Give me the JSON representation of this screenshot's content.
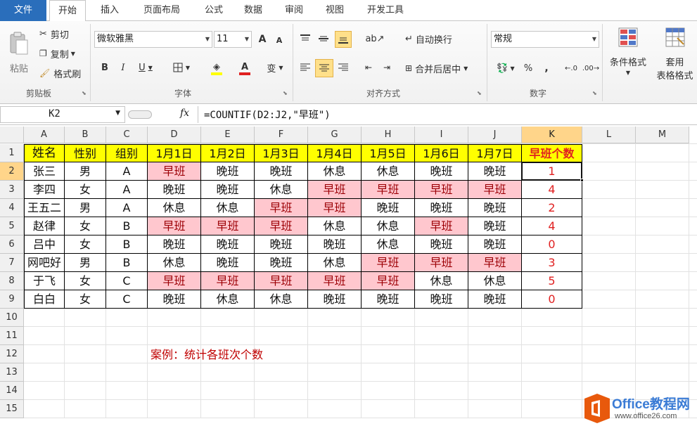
{
  "tabs": {
    "file": "文件",
    "items": [
      "开始",
      "插入",
      "页面布局",
      "公式",
      "数据",
      "审阅",
      "视图",
      "开发工具"
    ],
    "active_index": 0
  },
  "ribbon": {
    "clipboard": {
      "paste": "粘贴",
      "cut": "剪切",
      "copy": "复制",
      "format_painter": "格式刷",
      "group": "剪贴板"
    },
    "font": {
      "name": "微软雅黑",
      "size": "11",
      "group": "字体",
      "bold": "B",
      "italic": "I",
      "underline": "U",
      "grow": "A",
      "shrink": "A",
      "wen": "变"
    },
    "alignment": {
      "wrap": "自动换行",
      "merge": "合并后居中",
      "group": "对齐方式"
    },
    "number": {
      "format": "常规",
      "percent": "%",
      "comma": ",",
      "group": "数字"
    },
    "styles": {
      "conditional": "条件格式",
      "table_format_1": "套用",
      "table_format_2": "表格格式"
    }
  },
  "formula_bar": {
    "name_box": "K2",
    "fx": "fx",
    "formula": "=COUNTIF(D2:J2,\"早班\")"
  },
  "columns": [
    "A",
    "B",
    "C",
    "D",
    "E",
    "F",
    "G",
    "H",
    "I",
    "J",
    "K",
    "L",
    "M"
  ],
  "selected_column": "K",
  "selected_row": 2,
  "rows": [
    "1",
    "2",
    "3",
    "4",
    "5",
    "6",
    "7",
    "8",
    "9",
    "10",
    "11",
    "12",
    "13",
    "14",
    "15"
  ],
  "table": {
    "headers": [
      "姓名",
      "性别",
      "组别",
      "1月1日",
      "1月2日",
      "1月3日",
      "1月4日",
      "1月5日",
      "1月6日",
      "1月7日",
      "早班个数"
    ],
    "data": [
      [
        "张三",
        "男",
        "A",
        "早班",
        "晚班",
        "晚班",
        "休息",
        "休息",
        "晚班",
        "晚班",
        "1"
      ],
      [
        "李四",
        "女",
        "A",
        "晚班",
        "晚班",
        "休息",
        "早班",
        "早班",
        "早班",
        "早班",
        "4"
      ],
      [
        "王五二",
        "男",
        "A",
        "休息",
        "休息",
        "早班",
        "早班",
        "晚班",
        "晚班",
        "晚班",
        "2"
      ],
      [
        "赵律",
        "女",
        "B",
        "早班",
        "早班",
        "早班",
        "休息",
        "休息",
        "早班",
        "晚班",
        "4"
      ],
      [
        "吕中",
        "女",
        "B",
        "晚班",
        "晚班",
        "晚班",
        "晚班",
        "休息",
        "晚班",
        "晚班",
        "0"
      ],
      [
        "网吧好",
        "男",
        "B",
        "休息",
        "晚班",
        "晚班",
        "休息",
        "早班",
        "早班",
        "早班",
        "3"
      ],
      [
        "于飞",
        "女",
        "C",
        "早班",
        "早班",
        "早班",
        "早班",
        "早班",
        "休息",
        "休息",
        "5"
      ],
      [
        "白白",
        "女",
        "C",
        "晚班",
        "休息",
        "休息",
        "晚班",
        "晚班",
        "晚班",
        "晚班",
        "0"
      ]
    ]
  },
  "note": "案例：统计各班次个数",
  "watermark": {
    "brand": "Office教程网",
    "url": "www.office26.com"
  },
  "colors": {
    "header_fill": "#ffff00",
    "highlight_fill": "#ffc7ce",
    "highlight_text": "#9c0006",
    "count_text": "#e02020",
    "note_text": "#c00000",
    "file_tab": "#2a6ebb"
  }
}
